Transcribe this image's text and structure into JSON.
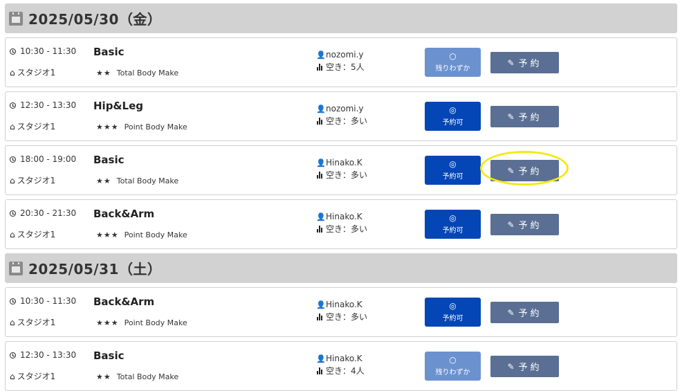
{
  "days": [
    {
      "date": "2025/05/30（金）",
      "lessons": [
        {
          "time": "10:30 - 11:30",
          "name": "Basic",
          "studio": "スタジオ1",
          "stars": "★★",
          "program": "Total Body Make",
          "instructor": "nozomi.y",
          "vacancy": "空き：5人",
          "status_symbol": "○",
          "status_label": "残りわずか",
          "status": "few",
          "reserve_label": "予約"
        },
        {
          "time": "12:30 - 13:30",
          "name": "Hip&Leg",
          "studio": "スタジオ1",
          "stars": "★★★",
          "program": "Point Body Make",
          "instructor": "nozomi.y",
          "vacancy": "空き：多い",
          "status_symbol": "◎",
          "status_label": "予約可",
          "status": "open",
          "reserve_label": "予約"
        },
        {
          "time": "18:00 - 19:00",
          "name": "Basic",
          "studio": "スタジオ1",
          "stars": "★★",
          "program": "Total Body Make",
          "instructor": "Hinako.K",
          "vacancy": "空き：多い",
          "status_symbol": "◎",
          "status_label": "予約可",
          "status": "open",
          "reserve_label": "予約"
        },
        {
          "time": "20:30 - 21:30",
          "name": "Back&Arm",
          "studio": "スタジオ1",
          "stars": "★★★",
          "program": "Point Body Make",
          "instructor": "Hinako.K",
          "vacancy": "空き：多い",
          "status_symbol": "◎",
          "status_label": "予約可",
          "status": "open",
          "reserve_label": "予約"
        }
      ]
    },
    {
      "date": "2025/05/31（土）",
      "lessons": [
        {
          "time": "10:30 - 11:30",
          "name": "Back&Arm",
          "studio": "スタジオ1",
          "stars": "★★★",
          "program": "Point Body Make",
          "instructor": "Hinako.K",
          "vacancy": "空き：多い",
          "status_symbol": "◎",
          "status_label": "予約可",
          "status": "open",
          "reserve_label": "予約"
        },
        {
          "time": "12:30 - 13:30",
          "name": "Basic",
          "studio": "スタジオ1",
          "stars": "★★",
          "program": "Total Body Make",
          "instructor": "Hinako.K",
          "vacancy": "空き：4人",
          "status_symbol": "○",
          "status_label": "残りわずか",
          "status": "few",
          "reserve_label": "予約"
        }
      ]
    }
  ],
  "colors": {
    "header_bg": "#d2d2d2",
    "status_open": "#0446b5",
    "status_few": "#6b92cf",
    "reserve_button": "#5a6f93",
    "highlight": "#f2ea12"
  }
}
